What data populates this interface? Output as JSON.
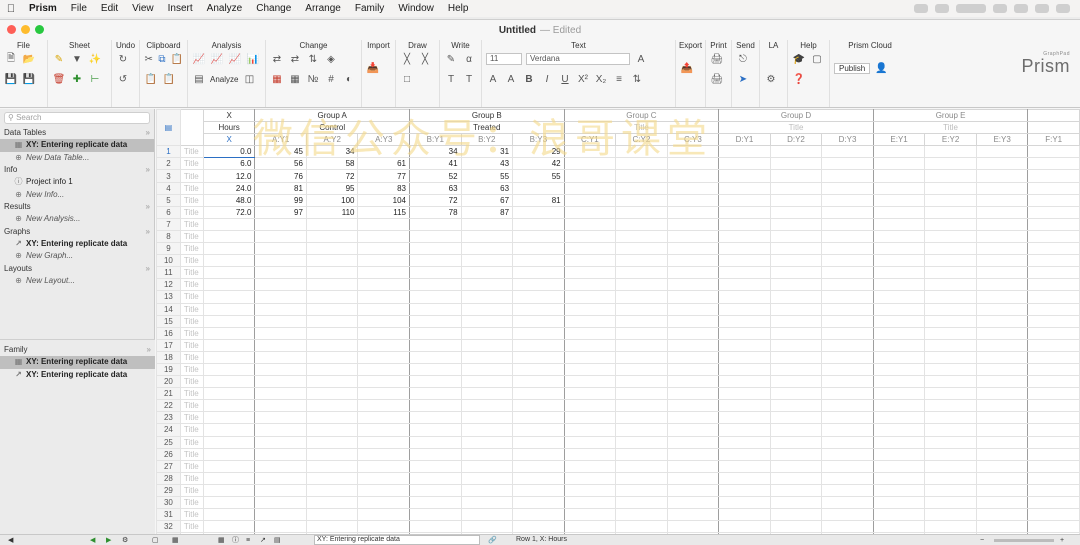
{
  "menubar": {
    "apple_icon": "apple-icon",
    "items": [
      "Prism",
      "File",
      "Edit",
      "View",
      "Insert",
      "Analyze",
      "Change",
      "Arrange",
      "Family",
      "Window",
      "Help"
    ]
  },
  "window": {
    "title": "Untitled",
    "title_suffix": "— Edited",
    "traffic_colors": [
      "#fe5f57",
      "#febc2e",
      "#28c840"
    ]
  },
  "toolbar": {
    "groups": [
      "File",
      "Sheet",
      "Undo",
      "Clipboard",
      "Analysis",
      "Change",
      "Import",
      "Draw",
      "Write",
      "Text",
      "Export",
      "Print",
      "Send",
      "LA",
      "Help",
      "Prism Cloud"
    ],
    "analyze_label": "Analyze",
    "font_size": "11",
    "font_name": "Verdana",
    "publish_label": "Publish",
    "logo_small": "GraphPad",
    "logo": "Prism"
  },
  "sidebar": {
    "search_placeholder": "Search",
    "sections": {
      "data_tables": "Data Tables",
      "info": "Info",
      "results": "Results",
      "graphs": "Graphs",
      "layouts": "Layouts"
    },
    "data_table_item": "XY: Entering replicate data",
    "new_data_table": "New Data Table...",
    "info_item": "Project info 1",
    "new_info": "New Info...",
    "new_analysis": "New Analysis...",
    "graph_item": "XY: Entering replicate data",
    "new_graph": "New Graph...",
    "new_layout": "New Layout...",
    "family_title": "Family",
    "family_items": [
      "XY: Entering replicate data",
      "XY: Entering replicate data"
    ]
  },
  "sheet": {
    "group_headers": [
      "X",
      "Group A",
      "Group B",
      "Group C",
      "Group D",
      "Group E"
    ],
    "group_titles": [
      "Hours",
      "Control",
      "Treated",
      "Title",
      "Title",
      "Title"
    ],
    "sub_headers": [
      "X",
      "A:Y1",
      "A:Y2",
      "A:Y3",
      "B:Y1",
      "B:Y2",
      "B:Y3",
      "C:Y1",
      "C:Y2",
      "C:Y3",
      "D:Y1",
      "D:Y2",
      "D:Y3",
      "E:Y1",
      "E:Y2",
      "E:Y3",
      "F:Y1"
    ],
    "row_title_placeholder": "Title",
    "row_count": 33,
    "x_values": [
      "0.0",
      "6.0",
      "12.0",
      "24.0",
      "48.0",
      "72.0"
    ],
    "a_values": [
      [
        "45",
        "34",
        ""
      ],
      [
        "56",
        "58",
        "61"
      ],
      [
        "76",
        "72",
        "77"
      ],
      [
        "81",
        "95",
        "83"
      ],
      [
        "99",
        "100",
        "104"
      ],
      [
        "97",
        "110",
        "115"
      ]
    ],
    "b_values": [
      [
        "34",
        "31",
        "29"
      ],
      [
        "41",
        "43",
        "42"
      ],
      [
        "52",
        "55",
        "55"
      ],
      [
        "63",
        "63",
        ""
      ],
      [
        "72",
        "67",
        "81"
      ],
      [
        "78",
        "87",
        ""
      ]
    ]
  },
  "statusbar": {
    "sheet_name": "XY: Entering replicate data",
    "row_info": "Row 1, X: Hours"
  },
  "watermark": "微信公众号：浪哥课堂"
}
